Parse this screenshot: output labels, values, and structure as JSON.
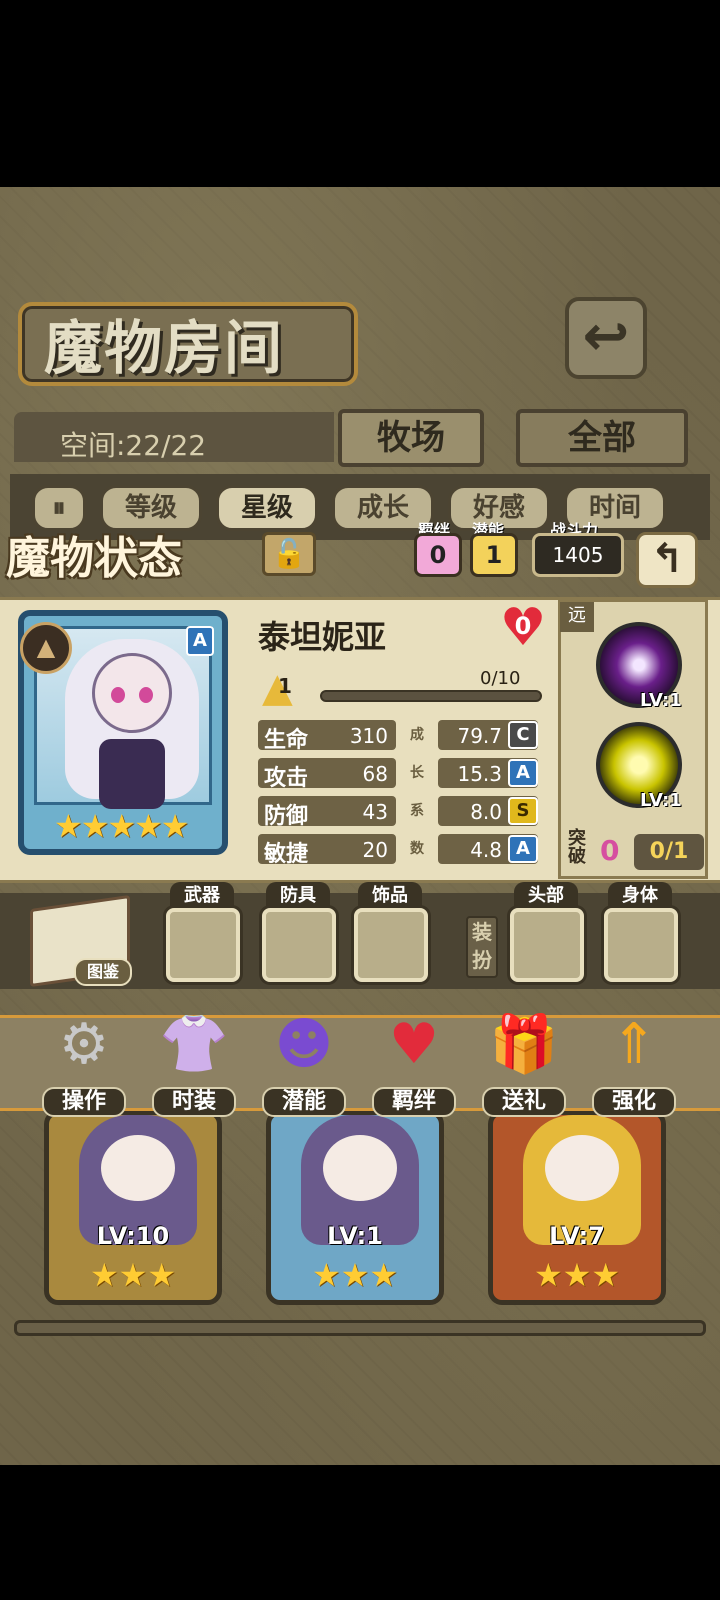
{
  "header": {
    "title": "魔物房间",
    "back_icon": "return-arrow-icon"
  },
  "space": {
    "label": "空间:22/22"
  },
  "tabs": [
    {
      "label": "牧场"
    },
    {
      "label": "全部"
    }
  ],
  "sort": {
    "toggle_icon": "pause-sort-icon",
    "buttons": [
      "等级",
      "星级",
      "成长",
      "好感",
      "时间"
    ],
    "active": "星级"
  },
  "status": {
    "title": "魔物状态",
    "bond_label": "羁绊",
    "bond_value": "0",
    "potential_label": "潜能",
    "potential_value": "1",
    "power_label": "战斗力",
    "power_value": "1405"
  },
  "monster": {
    "name": "泰坦妮亚",
    "rank": "A",
    "stars": "★★★★★",
    "affection": "0",
    "level": "1",
    "xp": "0/10",
    "stats": [
      {
        "label": "生命",
        "value": "310",
        "growth": "79.7",
        "grade": "C"
      },
      {
        "label": "攻击",
        "value": "68",
        "growth": "15.3",
        "grade": "A"
      },
      {
        "label": "防御",
        "value": "43",
        "growth": "8.0",
        "grade": "S"
      },
      {
        "label": "敏捷",
        "value": "20",
        "growth": "4.8",
        "grade": "A"
      }
    ],
    "growth_vertical": [
      "成",
      "长",
      "系",
      "数"
    ],
    "range": "远",
    "skills": [
      {
        "lv": "LV:1",
        "icon": "shadow-burst-icon"
      },
      {
        "lv": "LV:1",
        "icon": "lightning-shot-icon"
      }
    ],
    "breakthrough_label": "突破",
    "breakthrough_value": "0",
    "breakthrough_progress": "0/1"
  },
  "equipment": {
    "book_label": "图鉴",
    "slots": [
      "武器",
      "防具",
      "饰品",
      "头部",
      "身体"
    ],
    "outfit_label": "装扮"
  },
  "actions": [
    {
      "label": "操作",
      "icon": "gear-icon"
    },
    {
      "label": "时装",
      "icon": "outfit-icon"
    },
    {
      "label": "潜能",
      "icon": "demon-icon"
    },
    {
      "label": "羁绊",
      "icon": "hearts-icon"
    },
    {
      "label": "送礼",
      "icon": "gift-icon"
    },
    {
      "label": "强化",
      "icon": "upgrade-arrows-icon"
    }
  ],
  "roster": [
    {
      "lv": "LV:10",
      "stars": "★★★"
    },
    {
      "lv": "LV:1",
      "stars": "★★★"
    },
    {
      "lv": "LV:7",
      "stars": "★★★"
    }
  ],
  "colors": {
    "accent": "#d79a3b",
    "panel": "#e8dfbe",
    "dark": "#3a3324"
  }
}
